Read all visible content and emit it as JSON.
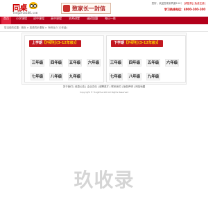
{
  "header": {
    "logo_text": "同桌",
    "logo_domain": "TongZhuo100.com",
    "banner_text": "致家长一封信",
    "top_links_prefix": "您好，欢迎您来到同桌100！",
    "top_links_action": "[请登录] [免费注册]",
    "hotline": "学习热线电话：4000-100-100"
  },
  "nav": {
    "items": [
      "首页",
      "小学课程",
      "初中课程",
      "高中课程",
      "名师讲堂",
      "诚招加盟",
      "每日一练"
    ]
  },
  "breadcrumb": "您当前的位置：首页 > 英语同步课程 > 外研社(3-12年级)",
  "panels": [
    {
      "title_main": "上学期",
      "title_sub": "【外研社(3-12年级)】",
      "grades": [
        "三年级",
        "四年级",
        "五年级",
        "六年级",
        "七年级",
        "八年级",
        "九年级"
      ]
    },
    {
      "title_main": "下学期",
      "title_sub": "【外研社(3-12年级)】",
      "grades": [
        "三年级",
        "四年级",
        "五年级",
        "六年级",
        "七年级",
        "八年级",
        "九年级"
      ]
    }
  ],
  "footer": {
    "links": "关于我们 | 信息公告 | 企业文化 | 诚聘英才 | 联系我们 | 版权声明 | 网站地图",
    "copyright": "Copyright © TongZhuo100 All Rights Reserved"
  },
  "watermark": "玖收录",
  "colors": {
    "nav_bg": "#b3001b",
    "accent_red": "#c21820",
    "title_highlight": "#ffd400"
  }
}
